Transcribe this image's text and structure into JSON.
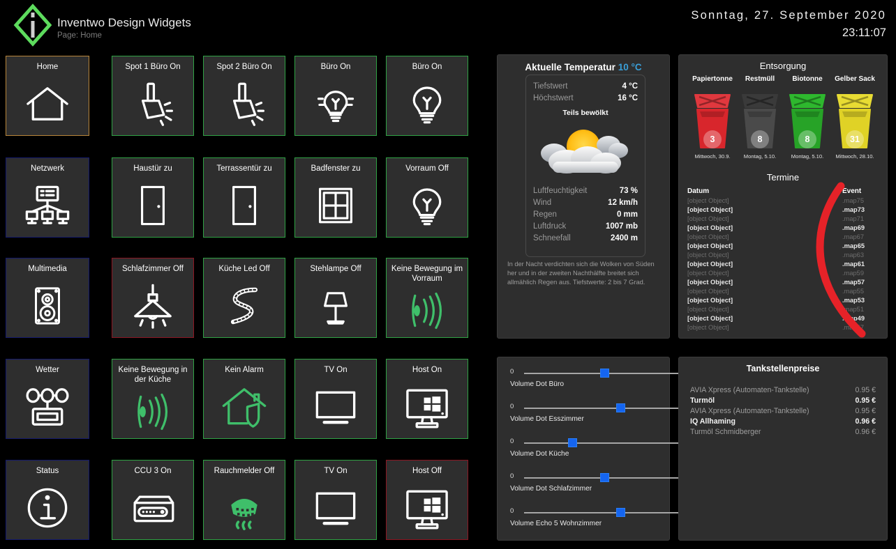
{
  "header": {
    "app_title": "Inventwo Design Widgets",
    "page_label": "Page: Home",
    "logo_icon": "inventwo-diamond-logo",
    "date": "Sonntag, 27. September 2020",
    "time": "23:11:07"
  },
  "sidebar": {
    "items": [
      {
        "label": "Home",
        "icon": "house-icon",
        "state": "active",
        "border": "#b8853a"
      },
      {
        "label": "Netzwerk",
        "icon": "network-icon",
        "state": "normal",
        "border": "#141a6e"
      },
      {
        "label": "Multimedia",
        "icon": "speaker-icon",
        "state": "normal",
        "border": "#141a6e"
      },
      {
        "label": "Wetter",
        "icon": "weather-station-icon",
        "state": "normal",
        "border": "#141a6e"
      },
      {
        "label": "Status",
        "icon": "info-circle-icon",
        "state": "normal",
        "border": "#141a6e"
      }
    ]
  },
  "tiles": [
    {
      "label": "Spot 1 Büro On",
      "icon": "spotlight-icon",
      "border": "green",
      "iconColor": "#ffffff"
    },
    {
      "label": "Spot 2 Büro On",
      "icon": "spotlight-icon",
      "border": "green",
      "iconColor": "#ffffff"
    },
    {
      "label": "Büro On",
      "icon": "bulb-on-icon",
      "border": "green",
      "iconColor": "#ffffff"
    },
    {
      "label": "Büro On",
      "icon": "bulb-icon",
      "border": "green",
      "iconColor": "#ffffff"
    },
    {
      "label": "Haustür zu",
      "icon": "door-icon",
      "border": "green",
      "iconColor": "#ffffff"
    },
    {
      "label": "Terrassentür zu",
      "icon": "door-icon",
      "border": "green",
      "iconColor": "#ffffff"
    },
    {
      "label": "Badfenster zu",
      "icon": "window-icon",
      "border": "green",
      "iconColor": "#ffffff"
    },
    {
      "label": "Vorraum Off",
      "icon": "bulb-icon",
      "border": "green",
      "iconColor": "#ffffff"
    },
    {
      "label": "Schlafzimmer Off",
      "icon": "ceiling-lamp-icon",
      "border": "red",
      "iconColor": "#ffffff"
    },
    {
      "label": "Küche Led Off",
      "icon": "led-strip-icon",
      "border": "green",
      "iconColor": "#ffffff"
    },
    {
      "label": "Stehlampe Off",
      "icon": "floor-lamp-icon",
      "border": "green",
      "iconColor": "#ffffff"
    },
    {
      "label": "Keine Bewegung im Vorraum",
      "icon": "motion-sensor-icon",
      "border": "green",
      "iconColor": "#3fbf6a"
    },
    {
      "label": "Keine Bewegung in der Küche",
      "icon": "motion-sensor-icon",
      "border": "green",
      "iconColor": "#3fbf6a"
    },
    {
      "label": "Kein Alarm",
      "icon": "alarm-house-icon",
      "border": "green",
      "iconColor": "#3fbf6a"
    },
    {
      "label": "TV On",
      "icon": "tv-icon",
      "border": "green",
      "iconColor": "#ffffff"
    },
    {
      "label": "Host On",
      "icon": "windows-pc-icon",
      "border": "green",
      "iconColor": "#ffffff"
    },
    {
      "label": "CCU 3 On",
      "icon": "ccu-router-icon",
      "border": "green",
      "iconColor": "#ffffff"
    },
    {
      "label": "Rauchmelder Off",
      "icon": "smoke-detector-icon",
      "border": "green",
      "iconColor": "#3fbf6a"
    },
    {
      "label": "TV On",
      "icon": "tv-icon",
      "border": "green",
      "iconColor": "#ffffff"
    },
    {
      "label": "Host Off",
      "icon": "windows-pc-icon",
      "border": "red",
      "iconColor": "#ffffff"
    }
  ],
  "weather": {
    "heading": "Aktuelle Temperatur",
    "current_temp": "10 °C",
    "low_label": "Tiefstwert",
    "low_value": "4 °C",
    "high_label": "Höchstwert",
    "high_value": "16 °C",
    "condition": "Teils bewölkt",
    "icon": "sun-behind-clouds-icon",
    "metrics": [
      {
        "label": "Luftfeuchtigkeit",
        "value": "73 %"
      },
      {
        "label": "Wind",
        "value": "12 km/h"
      },
      {
        "label": "Regen",
        "value": "0 mm"
      },
      {
        "label": "Luftdruck",
        "value": "1007 mb"
      },
      {
        "label": "Schneefall",
        "value": "2400 m"
      }
    ],
    "description": "In der Nacht verdichten sich die Wolken von Süden her und in der zweiten Nachthälfte breitet sich allmählich Regen aus. Tiefstwerte: 2 bis 7 Grad."
  },
  "entsorgung": {
    "title": "Entsorgung",
    "bins": [
      {
        "name": "Papiertonne",
        "days": "3",
        "date": "Mittwoch, 30.9.",
        "color": "#d8262c",
        "lid": "#e0383e"
      },
      {
        "name": "Restmüll",
        "days": "8",
        "date": "Montag, 5.10.",
        "color": "#4a4a4a",
        "lid": "#3a3a3a"
      },
      {
        "name": "Biotonne",
        "days": "8",
        "date": "Montag, 5.10.",
        "color": "#27a327",
        "lid": "#2eb82e"
      },
      {
        "name": "Gelber Sack",
        "days": "31",
        "date": "Mittwoch, 28.10.",
        "color": "#e0d226",
        "lid": "#e8dc33"
      }
    ]
  },
  "termine": {
    "title": "Termine",
    "col_date": "Datum",
    "col_event": "Event",
    "rows": [
      {
        "date": "[object Object]",
        "event": ".map75",
        "bright": false
      },
      {
        "date": "[object Object]",
        "event": ".map73",
        "bright": true
      },
      {
        "date": "[object Object]",
        "event": ".map71",
        "bright": false
      },
      {
        "date": "[object Object]",
        "event": ".map69",
        "bright": true
      },
      {
        "date": "[object Object]",
        "event": ".map67",
        "bright": false
      },
      {
        "date": "[object Object]",
        "event": ".map65",
        "bright": true
      },
      {
        "date": "[object Object]",
        "event": ".map63",
        "bright": false
      },
      {
        "date": "[object Object]",
        "event": ".map61",
        "bright": true
      },
      {
        "date": "[object Object]",
        "event": ".map59",
        "bright": false
      },
      {
        "date": "[object Object]",
        "event": ".map57",
        "bright": true
      },
      {
        "date": "[object Object]",
        "event": ".map55",
        "bright": false
      },
      {
        "date": "[object Object]",
        "event": ".map53",
        "bright": true
      },
      {
        "date": "[object Object]",
        "event": ".map51",
        "bright": false
      },
      {
        "date": "[object Object]",
        "event": ".map49",
        "bright": true
      },
      {
        "date": "[object Object]",
        "event": ".map47",
        "bright": false
      }
    ]
  },
  "tankstellen": {
    "title": "Tankstellenpreise",
    "rows": [
      {
        "name": "AVIA Xpress (Automaten-Tankstelle)",
        "price": "0.95 €",
        "bright": false
      },
      {
        "name": "Turmöl",
        "price": "0.95 €",
        "bright": true
      },
      {
        "name": "AVIA Xpress (Automaten-Tankstelle)",
        "price": "0.95 €",
        "bright": false
      },
      {
        "name": "IQ Allhaming",
        "price": "0.96 €",
        "bright": true
      },
      {
        "name": "Turmöl Schmidberger",
        "price": "0.96 €",
        "bright": false
      }
    ]
  },
  "sliders": [
    {
      "label": "Volume Dot Büro",
      "min": "0",
      "max": "100",
      "value": "50"
    },
    {
      "label": "Volume Dot Esszimmer",
      "min": "0",
      "max": "100",
      "value": "60"
    },
    {
      "label": "Volume Dot Küche",
      "min": "0",
      "max": "100",
      "value": "30"
    },
    {
      "label": "Volume Dot Schlafzimmer",
      "min": "0",
      "max": "100",
      "value": "50"
    },
    {
      "label": "Volume Echo 5 Wohnzimmer",
      "min": "0",
      "max": "100",
      "value": "60"
    }
  ],
  "overlay": {
    "annotation": "red-curve-annotation",
    "color": "#e62228"
  },
  "colors": {
    "background": "#000000",
    "tile_bg": "#2e2e2e",
    "on_border": "#2fa244",
    "off_border": "#8d1622",
    "nav_border": "#141a6e",
    "active_border": "#b8853a",
    "accent_blue": "#3a9fd8",
    "slider_blue": "#1565f0"
  }
}
